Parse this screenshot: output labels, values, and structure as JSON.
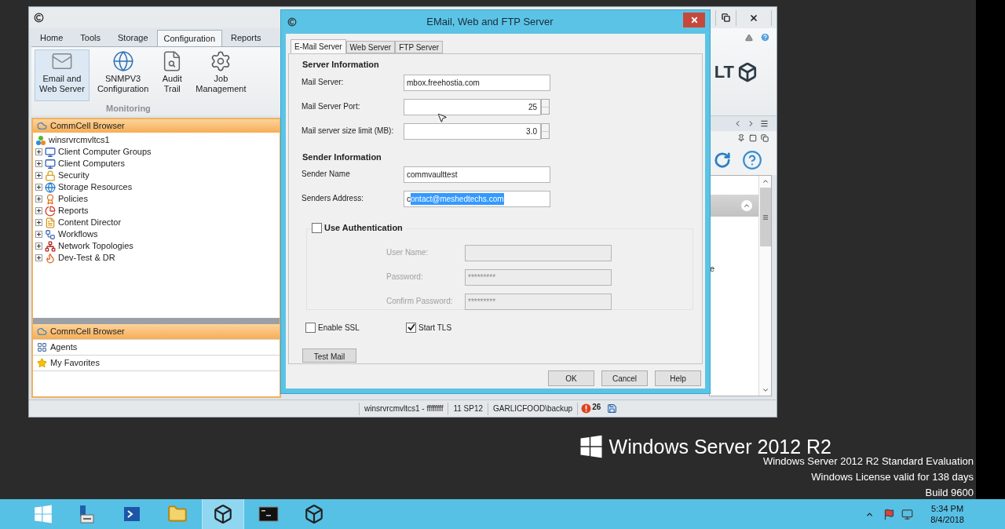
{
  "main_window": {
    "ribbon_tabs": [
      {
        "label": "Home",
        "selected": false
      },
      {
        "label": "Tools",
        "selected": false
      },
      {
        "label": "Storage",
        "selected": false
      },
      {
        "label": "Configuration",
        "selected": true
      },
      {
        "label": "Reports",
        "selected": false
      }
    ],
    "ribbon_buttons": [
      {
        "lines": [
          "Email and",
          "Web Server"
        ],
        "selected": true
      },
      {
        "lines": [
          "SNMPV3",
          "Configuration"
        ],
        "selected": false
      },
      {
        "lines": [
          "Audit",
          "Trail"
        ],
        "selected": false
      },
      {
        "lines": [
          "Job",
          "Management"
        ],
        "selected": false
      }
    ],
    "ribbon_group": "Monitoring",
    "brand_fragment": "LT",
    "browser": {
      "title": "CommCell Browser",
      "root": "winsrvrcmvltcs1",
      "items": [
        {
          "label": "Client Computer Groups",
          "expanded": false
        },
        {
          "label": "Client Computers",
          "expanded": false
        },
        {
          "label": "Security",
          "expanded": false
        },
        {
          "label": "Storage Resources",
          "expanded": false
        },
        {
          "label": "Policies",
          "expanded": false
        },
        {
          "label": "Reports",
          "expanded": false
        },
        {
          "label": "Content Director",
          "expanded": false
        },
        {
          "label": "Workflows",
          "expanded": false
        },
        {
          "label": "Network Topologies",
          "expanded": false
        },
        {
          "label": "Dev-Test & DR",
          "expanded": false
        }
      ]
    },
    "nav_items": [
      {
        "label": "CommCell Browser",
        "selected": true
      },
      {
        "label": "Agents",
        "selected": false
      },
      {
        "label": "My Favorites",
        "selected": false
      }
    ],
    "right_pane_fragment": "e",
    "status_bar": [
      "winsrvrcmvltcs1 - ffffffff",
      "11 SP12",
      "GARLICFOOD\\backup"
    ],
    "alert_count": "26"
  },
  "dialog": {
    "title": "EMail, Web and FTP Server",
    "tabs": [
      {
        "label": "E-Mail Server",
        "selected": true
      },
      {
        "label": "Web Server",
        "selected": false
      },
      {
        "label": "FTP Server",
        "selected": false
      }
    ],
    "server_heading": "Server Information",
    "mail_server": {
      "label": "Mail Server:",
      "value": "mbox.freehostia.com"
    },
    "mail_port": {
      "label": "Mail Server Port:",
      "value": "25"
    },
    "size_limit": {
      "label": "Mail server size limit (MB):",
      "value": "3.0"
    },
    "sender_heading": "Sender Information",
    "sender_name": {
      "label": "Sender Name",
      "value": "commvaulttest"
    },
    "sender_address": {
      "label": "Senders Address:",
      "value_parts": [
        {
          "text": "c",
          "selected": false
        },
        {
          "text": "ontact@meshedtechs.com",
          "selected": true
        }
      ]
    },
    "use_authentication": {
      "label": "Use Authentication",
      "checked": false
    },
    "auth_fields": [
      {
        "label": "User Name:",
        "disabled": true
      },
      {
        "label": "Password:",
        "value": "*********",
        "disabled": true
      },
      {
        "label": "Confirm Password:",
        "value": "*********",
        "disabled": true
      }
    ],
    "enable_ssl": {
      "label": "Enable SSL",
      "checked": false
    },
    "start_tls": {
      "label": "Start TLS",
      "checked": true
    },
    "test_button": "Test Mail",
    "buttons": [
      "OK",
      "Cancel",
      "Help"
    ]
  },
  "desktop": {
    "brand": "Windows Server 2012 R2",
    "watermark_lines": [
      "Windows Server 2012 R2 Standard Evaluation",
      "Windows License valid for 138 days",
      "Build 9600"
    ]
  },
  "taskbar": {
    "apps": [
      {
        "selected": false
      },
      {
        "selected": false
      },
      {
        "selected": false
      },
      {
        "selected": true
      },
      {
        "selected": false
      },
      {
        "selected": false
      }
    ],
    "time": "5:34 PM",
    "date": "8/4/2018"
  }
}
